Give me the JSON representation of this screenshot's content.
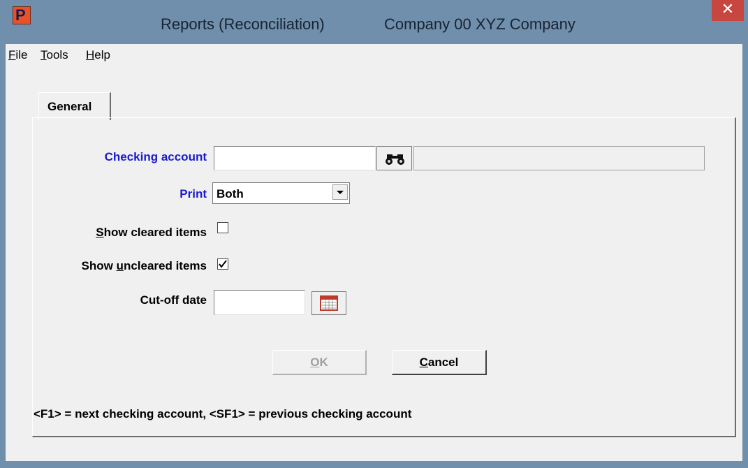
{
  "window": {
    "title_left": "Reports (Reconciliation)",
    "title_right": "Company 00  XYZ Company",
    "close_glyph": "✕",
    "app_icon_letter": "P"
  },
  "menu": {
    "file": "ile",
    "file_u": "F",
    "tools": "ools",
    "tools_u": "T",
    "help": "elp",
    "help_u": "H"
  },
  "tab": {
    "general": "General"
  },
  "form": {
    "checking_account_label": "Checking account",
    "checking_account_value": "",
    "checking_account_desc": "",
    "print_label": "Print",
    "print_value": "Both",
    "show_cleared_label_u": "S",
    "show_cleared_label": "how cleared items",
    "show_cleared_checked": false,
    "show_uncleared_label_pre": "Show ",
    "show_uncleared_label_u": "u",
    "show_uncleared_label": "ncleared items",
    "show_uncleared_checked": true,
    "cutoff_label": "Cut-off date",
    "cutoff_value": ""
  },
  "buttons": {
    "ok_u": "O",
    "ok": "K",
    "cancel_u": "C",
    "cancel": "ancel"
  },
  "status": "<F1> = next checking account, <SF1> = previous checking account",
  "colors": {
    "titlebar": "#6f8fad",
    "close": "#c7463f",
    "label_blue": "#1a1ad0",
    "app_icon": "#e8522a"
  },
  "icons": {
    "lookup": "binoculars-icon",
    "calendar": "calendar-icon",
    "dropdown": "chevron-down-icon",
    "check": "checkmark-icon"
  }
}
